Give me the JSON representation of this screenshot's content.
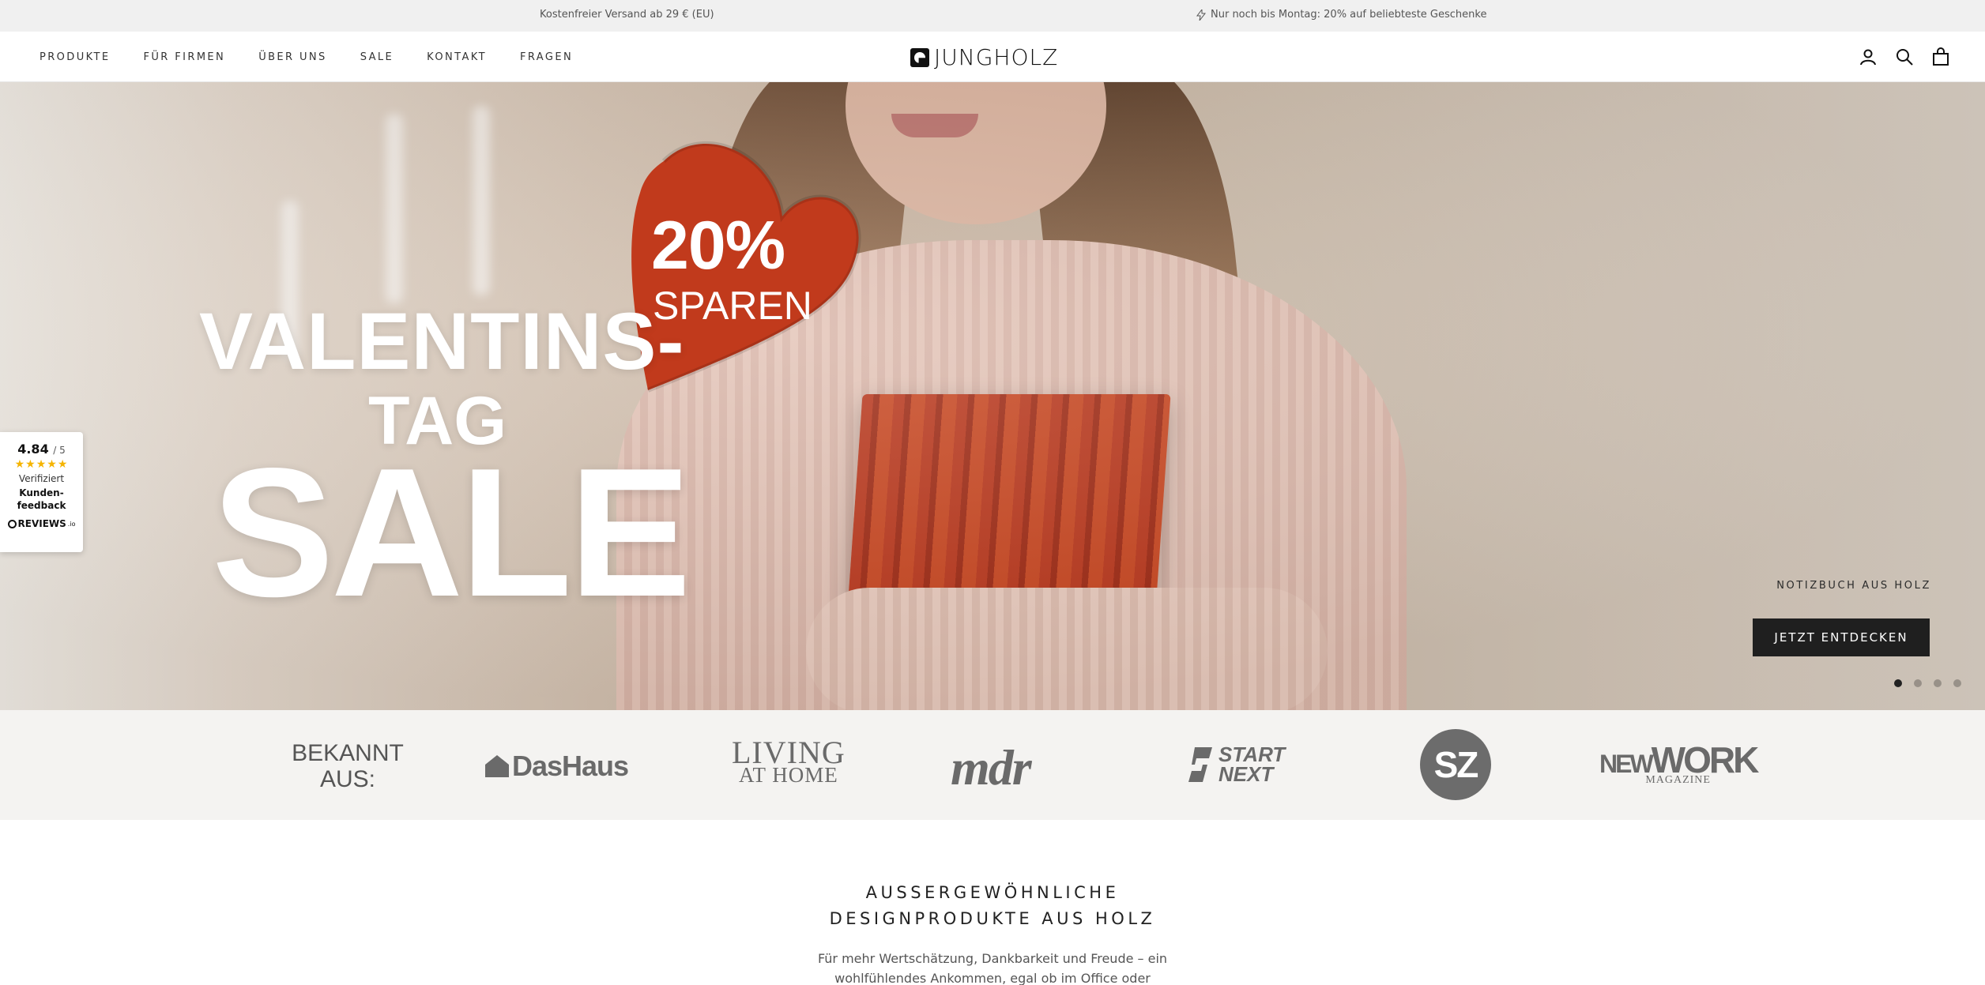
{
  "announcement": {
    "left": "Kostenfreier Versand ab 29 € (EU)",
    "right": "Nur noch bis Montag: 20% auf beliebteste Geschenke",
    "right_icon": "bolt-icon"
  },
  "header": {
    "nav": [
      "PRODUKTE",
      "FÜR FIRMEN",
      "ÜBER UNS",
      "SALE",
      "KONTAKT",
      "FRAGEN"
    ],
    "logo_text": "JUNGHOLZ",
    "icons": [
      "account-icon",
      "search-icon",
      "cart-icon"
    ]
  },
  "hero": {
    "badge_big": "20%",
    "badge_small": "SPAREN",
    "headline_1": "VALENTINS-",
    "headline_2": "TAG",
    "headline_3": "SALE",
    "subtitle": "NOTIZBUCH AUS HOLZ",
    "cta": "JETZT ENTDECKEN",
    "slides": 4,
    "active_slide": 1,
    "heart_color": "#c13a1c"
  },
  "reviews": {
    "score": "4.84",
    "scale": "/ 5",
    "stars": "★★★★★",
    "verified": "Verifiziert",
    "feedback_1": "Kunden-",
    "feedback_2": "feedback",
    "brand": "REVIEWS",
    "brand_suffix": ".io"
  },
  "press": {
    "label_1": "BEKANNT",
    "label_2": "AUS:",
    "logos": {
      "dashaus": "DasHaus",
      "living_1": "LIVING",
      "living_2": "AT HOME",
      "mdr": "mdr",
      "startnext_1": "START",
      "startnext_2": "NEXT",
      "sz": "SZ",
      "newwork_1": "NEW",
      "newwork_2": "WORK",
      "newwork_3": "MAGAZINE"
    }
  },
  "intro": {
    "title_1": "AUSSERGEWÖHNLICHE",
    "title_2": "DESIGNPRODUKTE AUS HOLZ",
    "text": "Für mehr Wertschätzung, Dankbarkeit und Freude – ein wohlfühlendes Ankommen, egal ob im Office oder"
  }
}
